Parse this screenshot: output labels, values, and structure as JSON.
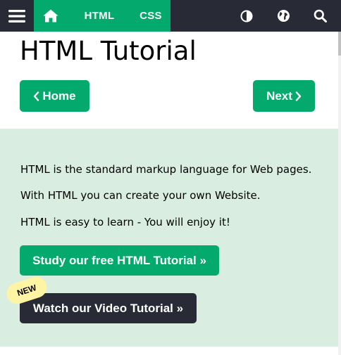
{
  "nav": {
    "html_label": "HTML",
    "css_label": "CSS",
    "icons": {
      "menu": "hamburger-menu-icon",
      "home": "home-icon",
      "theme": "contrast-icon",
      "globe": "globe-icon",
      "search": "search-icon"
    }
  },
  "page": {
    "title": "HTML Tutorial",
    "prev_label": "Home",
    "next_label": "Next"
  },
  "intro": {
    "line1": "HTML is the standard markup language for Web pages.",
    "line2": "With HTML you can create your own Website.",
    "line3": "HTML is easy to learn - You will enjoy it!"
  },
  "cta": {
    "study_label": "Study our free HTML Tutorial »",
    "video_label": "Watch our Video Tutorial »",
    "new_badge": "NEW"
  },
  "colors": {
    "brand_green": "#04aa6d",
    "dark": "#282a35",
    "panel_bg": "#d9eee1",
    "badge_yellow": "#fff4a3"
  }
}
